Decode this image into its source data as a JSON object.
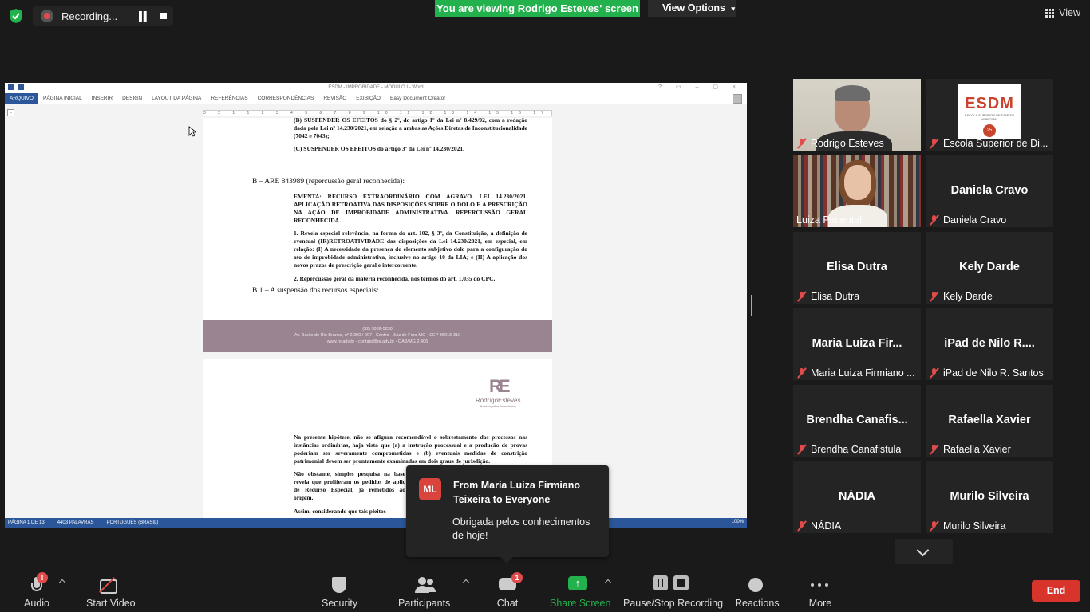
{
  "top": {
    "recording_label": "Recording...",
    "viewing_banner": "You are viewing Rodrigo Esteves' screen",
    "view_options_label": "View Options",
    "view_label": "View"
  },
  "word": {
    "title": "ESDM - IMPROBIDADE - MÓDULO I - Word",
    "tabs": [
      "ARQUIVO",
      "PÁGINA INICIAL",
      "INSERIR",
      "DESIGN",
      "LAYOUT DA PÁGINA",
      "REFERÊNCIAS",
      "CORRESPONDÊNCIAS",
      "REVISÃO",
      "EXIBIÇÃO",
      "Easy Document Creator"
    ],
    "ruler_text": "3 2 1 1 2 3 4 5 6 7 8 9 10 11 12 13 14 15 16 17",
    "page1": {
      "p_top": "(B) SUSPENDER OS EFEITOS do § 2º, do artigo 1º da Lei nº 8.429/92, com a redação dada pela Lei nº 14.230/2021, em relação a ambas as Ações Diretas de Inconstitucionalidade (7042 e 7043);",
      "p_c": "(C) SUSPENDER OS EFEITOS do artigo 3º da Lei nº 14.230/2021.",
      "head_b": "B – ARE 843989 (repercussão geral reconhecida):",
      "ementa": "EMENTA: RECURSO EXTRAORDINÁRIO COM AGRAVO. LEI 14.230/2021. APLICAÇÃO RETROATIVA DAS DISPOSIÇÕES SOBRE O DOLO E A PRESCRIÇÃO NA AÇÃO DE IMPROBIDADE ADMINISTRATIVA. REPERCUSSÃO GERAL RECONHECIDA.",
      "item1": "1. Revela especial relevância, na forma do art. 102, § 3º, da Constituição, a definição de eventual (IR)RETROATIVIDADE das disposições da Lei 14.230/2021, em especial, em relação: (I) A necessidade da presença do elemento subjetivo dolo para a configuração do ato de improbidade administrativa, inclusive no artigo 10 da LIA; e (II) A aplicação dos novos prazos de prescrição geral e intercorrente.",
      "item2": "2. Repercussão geral da matéria reconhecida, nos termos do art. 1.035 do CPC.",
      "head_b1": "B.1 – A suspensão dos recursos especiais:",
      "footer1": "(32) 3062-5230",
      "footer2": "Av. Barão do Rio Branco, nº 2.390 / 907 - Centro - Juiz de Fora-MG - CEP 36016-310",
      "footer3": "www.re.adv.br - contato@re.adv.br - OAB/MG 2.406"
    },
    "page2": {
      "logo_mark": "RE",
      "logo_name": "RodrigoEsteves",
      "logo_sub": "& Advogados Associados",
      "p1": "Na presente hipótese, não se afigura recomendável o sobrestamento dos processos nas instâncias ordinárias, haja vista que (a) a instrução processual e a produção de provas poderiam ser severamente comprometidas e (b) eventuais medidas de constrição patrimonial devem ser prontamente examinadas em dois graus de jurisdição.",
      "p2": "Não obstante, simples pesquisa na base revela que proliferam os pedidos de aplic de Recurso Especial, já remetidos ao origem.",
      "p3": "Assim, considerando que tais pleitos"
    },
    "status": {
      "page": "PÁGINA 1 DE 13",
      "words": "4403 PALAVRAS",
      "lang": "PORTUGUÊS (BRASIL)",
      "zoom": "100%"
    }
  },
  "participants": [
    {
      "name": "Rodrigo Esteves",
      "big": "",
      "video": "rodrigo"
    },
    {
      "name": "Escola Superior de Di...",
      "big": "",
      "video": "esdm"
    },
    {
      "name": "Luiza Pimentel",
      "big": "",
      "video": "luiza"
    },
    {
      "name": "Daniela Cravo",
      "big": "Daniela Cravo",
      "video": ""
    },
    {
      "name": "Elisa Dutra",
      "big": "Elisa Dutra",
      "video": ""
    },
    {
      "name": "Kely Darde",
      "big": "Kely Darde",
      "video": ""
    },
    {
      "name": "Maria Luiza Firmiano ...",
      "big": "Maria Luiza Fir...",
      "video": ""
    },
    {
      "name": "iPad de Nilo R. Santos",
      "big": "iPad de Nilo R....",
      "video": ""
    },
    {
      "name": "Brendha Canafistula",
      "big": "Brendha Canafis...",
      "video": ""
    },
    {
      "name": "Rafaella Xavier",
      "big": "Rafaella Xavier",
      "video": ""
    },
    {
      "name": "NÁDIA",
      "big": "NÁDIA",
      "video": ""
    },
    {
      "name": "Murilo Silveira",
      "big": "Murilo Silveira",
      "video": ""
    }
  ],
  "esdm_logo": {
    "title": "ESDM",
    "sub": "ESCOLA SUPERIOR DE DIREITO MUNICIPAL",
    "years": "25"
  },
  "toast": {
    "initials": "ML",
    "from": "From Maria Luiza Firmiano Teixeira to Everyone",
    "message": "Obrigada pelos conhecimentos de hoje!"
  },
  "toolbar": {
    "audio": "Audio",
    "audio_badge": "!",
    "start_video": "Start Video",
    "security": "Security",
    "participants": "Participants",
    "chat": "Chat",
    "chat_badge": "1",
    "share_screen": "Share Screen",
    "pause_stop": "Pause/Stop Recording",
    "reactions": "Reactions",
    "more": "More",
    "end": "End"
  },
  "colors": {
    "accent_green": "#23b14d",
    "end_red": "#d9342b",
    "word_blue": "#2b579a"
  }
}
